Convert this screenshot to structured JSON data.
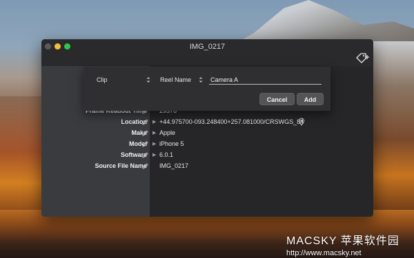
{
  "window": {
    "title": "IMG_0217"
  },
  "dialog": {
    "first_select": "Clip",
    "second_select": "Reel Name",
    "text_value": "Camera A",
    "cancel_label": "Cancel",
    "add_label": "Add"
  },
  "metadata_rows": [
    {
      "label": "Frame Readout Time",
      "value": "29376",
      "has_arrow": false
    },
    {
      "label": "Location",
      "value": "+44.975700-093.248400+257.081000/CRSWGS_84",
      "has_arrow": true
    },
    {
      "label": "Make",
      "value": "Apple",
      "has_arrow": true
    },
    {
      "label": "Model",
      "value": "iPhone 5",
      "has_arrow": true
    },
    {
      "label": "Software",
      "value": "6.0.1",
      "has_arrow": true
    },
    {
      "label": "Source File Name",
      "value": "IMG_0217",
      "has_arrow": false
    }
  ],
  "watermark": {
    "line1": "MACSKY 苹果软件园",
    "line2": "http://www.macsky.net"
  },
  "colors": {
    "window_bg": "#222224",
    "sidebar_bg": "#3a3b3f",
    "close": "#5a5a5c",
    "minimize": "#f4bd3c",
    "maximize": "#2ec84a"
  },
  "icons": [
    "tag-add-icon",
    "pencil-icon",
    "disclosure-arrow-icon",
    "location-pin-icon",
    "stepper-icon"
  ]
}
